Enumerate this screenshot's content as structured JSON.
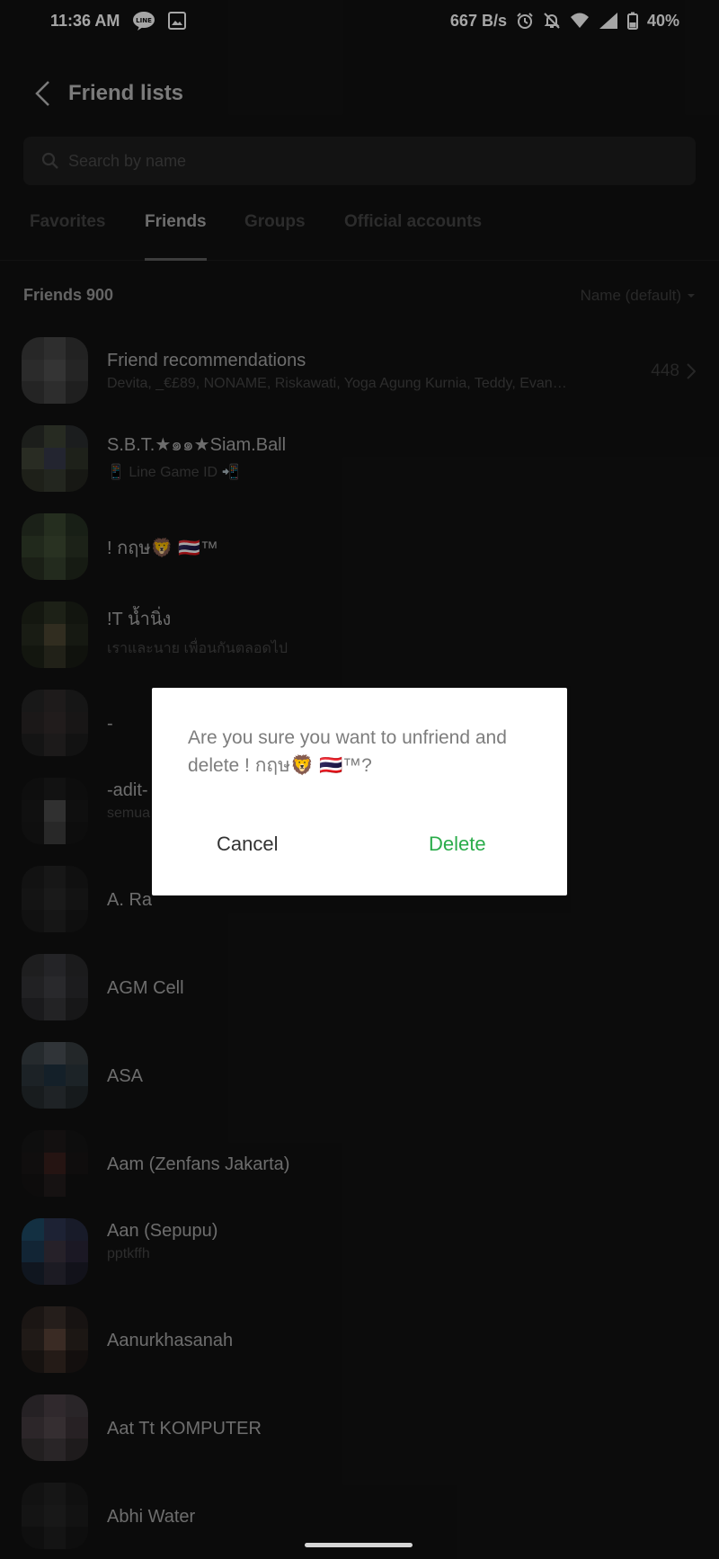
{
  "status_bar": {
    "time": "11:36 AM",
    "network_speed": "667 B/s",
    "battery": "40%",
    "icons": [
      "line-app-icon",
      "gallery-icon",
      "alarm-icon",
      "mute-icon",
      "wifi-icon",
      "signal-icon",
      "battery-icon"
    ]
  },
  "header": {
    "title": "Friend lists"
  },
  "search": {
    "placeholder": "Search by name"
  },
  "tabs": [
    {
      "label": "Favorites"
    },
    {
      "label": "Friends"
    },
    {
      "label": "Groups"
    },
    {
      "label": "Official accounts"
    }
  ],
  "active_tab": "Friends",
  "list_header": {
    "count_label": "Friends 900",
    "sort_label": "Name (default)"
  },
  "recommendations": {
    "title": "Friend recommendations",
    "names": "Devita, _€£89, NONAME, Riskawati, Yoga Agung Kurnia, Teddy, Evan…",
    "count": "448"
  },
  "friends": [
    {
      "name": "S.B.T.★๑๑★Siam.Ball",
      "status": "📱 Line Game ID 📲"
    },
    {
      "name": "! กฤษ🦁 🇹🇭™",
      "status": ""
    },
    {
      "name": "!T น้ำนิ่ง",
      "status": "เราและนาย เพื่อนกันตลอดไป"
    },
    {
      "name": "-",
      "status": ""
    },
    {
      "name": "-adit-",
      "status": "semua"
    },
    {
      "name": "A. Ra",
      "status": ""
    },
    {
      "name": "AGM Cell",
      "status": ""
    },
    {
      "name": "ASA",
      "status": ""
    },
    {
      "name": "Aam (Zenfans Jakarta)",
      "status": ""
    },
    {
      "name": "Aan (Sepupu)",
      "status": "pptkffh"
    },
    {
      "name": "Aanurkhasanah",
      "status": ""
    },
    {
      "name": "Aat Tt KOMPUTER",
      "status": ""
    },
    {
      "name": "Abhi Water",
      "status": ""
    }
  ],
  "dialog": {
    "message": "Are you sure you want to unfriend and delete ! กฤษ🦁 🇹🇭™?",
    "cancel_label": "Cancel",
    "delete_label": "Delete",
    "delete_color": "#2aac4a"
  }
}
